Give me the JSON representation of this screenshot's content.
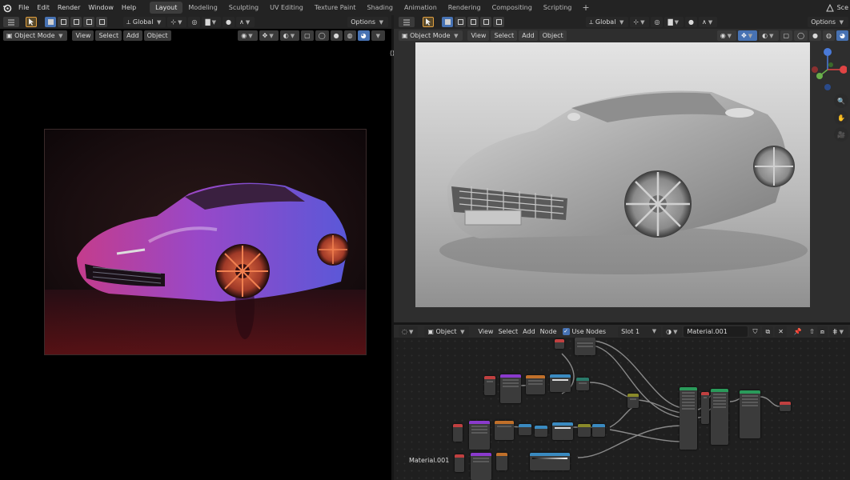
{
  "menu": [
    "File",
    "Edit",
    "Render",
    "Window",
    "Help"
  ],
  "workspaces": [
    "Layout",
    "Modeling",
    "Sculpting",
    "UV Editing",
    "Texture Paint",
    "Shading",
    "Animation",
    "Rendering",
    "Compositing",
    "Scripting"
  ],
  "active_workspace": "Layout",
  "workspace_add": "+",
  "scene_label": "Sce",
  "left_toolbar": {
    "transform": "Global",
    "options": "Options"
  },
  "right_toolbar": {
    "transform": "Global",
    "options": "Options"
  },
  "left_viewport_header": {
    "mode": "Object Mode",
    "view": "View",
    "select": "Select",
    "add": "Add",
    "object": "Object"
  },
  "right_viewport_header": {
    "mode": "Object Mode",
    "view": "View",
    "select": "Select",
    "add": "Add",
    "object": "Object"
  },
  "node_header": {
    "object": "Object",
    "view": "View",
    "select": "Select",
    "add": "Add",
    "node": "Node",
    "use_nodes": "Use Nodes",
    "slot": "Slot 1",
    "material": "Material.001"
  },
  "node_area_label": "Material.001",
  "colors": {
    "accent": "#4772b3",
    "active_tool": "#e2a040",
    "bg": "#1d1d1d"
  }
}
